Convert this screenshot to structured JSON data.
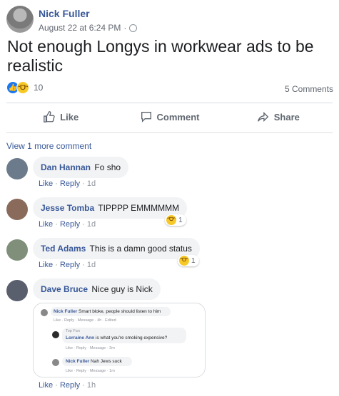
{
  "post": {
    "author": "Nick Fuller",
    "timestamp": "August 22 at 6:24 PM",
    "privacy_icon": "globe-icon",
    "text": "Not enough Longys in workwear ads to be realistic",
    "reaction_count": "10",
    "comment_count": "5 Comments"
  },
  "actions": {
    "like": "Like",
    "comment": "Comment",
    "share": "Share"
  },
  "view_more": "View 1 more comment",
  "comments": [
    {
      "name": "Dan Hannan",
      "text": "Fo sho",
      "like": "Like",
      "reply": "Reply",
      "time": "1d"
    },
    {
      "name": "Jesse Tomba",
      "text": "TIPPPP EMMMMMM",
      "like": "Like",
      "reply": "Reply",
      "time": "1d",
      "reaction_count": "1"
    },
    {
      "name": "Ted Adams",
      "text": "This is a damn good status",
      "like": "Like",
      "reply": "Reply",
      "time": "1d",
      "reaction_count": "1"
    },
    {
      "name": "Dave Bruce",
      "text": "Nice guy is Nick",
      "like": "Like",
      "reply": "Reply",
      "time": "1h"
    }
  ],
  "screenshot": {
    "r1_name": "Nick Fuller",
    "r1_text": "Smart bloke, people should listen to him",
    "r1_meta": "Like · Reply · Message · 4h · Edited",
    "r2_badge": "Top Fan",
    "r2_name": "Lorraine Ann",
    "r2_text": "is what you're smoking expensive?",
    "r2_meta": "Like · Reply · Message · 3m",
    "r3_name": "Nick Fuller",
    "r3_text": "Nah Jews suck",
    "r3_meta": "Like · Reply · Message · 1m"
  },
  "colors": {
    "link": "#385898",
    "like_blue": "#1877f2",
    "haha_yellow": "#f7c928"
  }
}
